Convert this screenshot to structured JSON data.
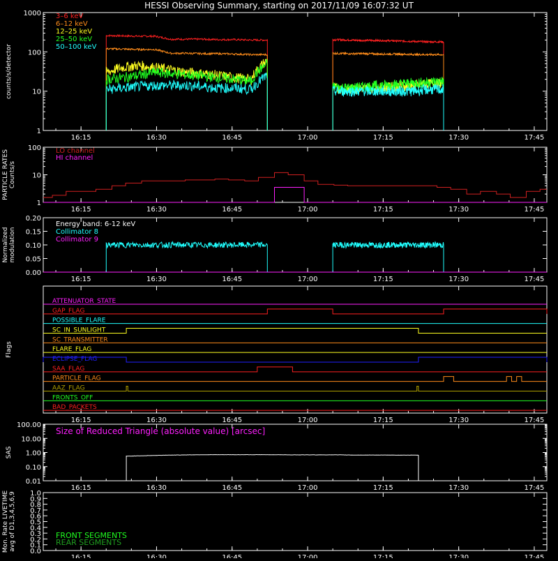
{
  "title": "HESSI Observing Summary, starting on 2017/11/09 16:07:32 UT",
  "time_labels": [
    "16:15",
    "16:30",
    "16:45",
    "17:00",
    "17:15",
    "17:30",
    "17:45"
  ],
  "time_values": [
    7.5,
    22.5,
    37.5,
    52.5,
    67.5,
    82.5,
    97.5
  ],
  "x_range_min": [
    0,
    100
  ],
  "colors": {
    "red": "#ff2020",
    "orange": "#ff8c1a",
    "yellow": "#ffff20",
    "green": "#20ff20",
    "cyan": "#20ffff",
    "magenta": "#ff20ff",
    "blue": "#2020ff",
    "darkred": "#d02020",
    "olive": "#b0a000",
    "sas": "#ffffff",
    "live_front": "#20ff20",
    "live_rear": "#20a020"
  },
  "chart_data": [
    {
      "id": "count-rates",
      "type": "line",
      "ylabel": "counts/s/detector",
      "scale": "log",
      "ylim": [
        1,
        1000
      ],
      "yticks": [
        {
          "v": 1,
          "t": "1"
        },
        {
          "v": 10,
          "t": "10"
        },
        {
          "v": 100,
          "t": "100"
        },
        {
          "v": 1000,
          "t": "1000"
        }
      ],
      "legend": [
        "3–6 keV",
        "6–12 keV",
        "12–25 keV",
        "25–50 keV",
        "50–100 keV"
      ],
      "series": [
        {
          "name": "3–6 keV",
          "color": "red",
          "segments": [
            {
              "t0": 12.5,
              "t1": 44.5,
              "values": [
                260,
                255,
                250,
                250,
                210,
                210,
                210,
                205,
                205,
                200,
                200
              ]
            },
            {
              "t0": 57.5,
              "t1": 79.5,
              "values": [
                205,
                200,
                195,
                195,
                190,
                185,
                180,
                180
              ]
            }
          ]
        },
        {
          "name": "6–12 keV",
          "color": "orange",
          "segments": [
            {
              "t0": 12.5,
              "t1": 44.5,
              "values": [
                120,
                118,
                115,
                115,
                92,
                92,
                90,
                90,
                88,
                85,
                85
              ]
            },
            {
              "t0": 57.5,
              "t1": 79.5,
              "values": [
                92,
                90,
                90,
                88,
                88,
                86,
                85,
                85
              ]
            }
          ]
        },
        {
          "name": "12–25 keV",
          "color": "yellow",
          "segments": [
            {
              "t0": 12.5,
              "t1": 44.5,
              "values": [
                30,
                40,
                45,
                40,
                35,
                30,
                28,
                25,
                22,
                20,
                60
              ]
            },
            {
              "t0": 57.5,
              "t1": 79.5,
              "values": [
                12,
                11,
                12,
                12,
                13,
                14,
                15,
                16
              ]
            }
          ]
        },
        {
          "name": "25–50 keV",
          "color": "green",
          "segments": [
            {
              "t0": 12.5,
              "t1": 44.5,
              "values": [
                20,
                22,
                25,
                30,
                28,
                26,
                24,
                22,
                20,
                18,
                50
              ]
            },
            {
              "t0": 57.5,
              "t1": 79.5,
              "values": [
                13,
                12,
                13,
                14,
                15,
                16,
                17,
                18
              ]
            }
          ]
        },
        {
          "name": "50–100 keV",
          "color": "cyan",
          "segments": [
            {
              "t0": 12.5,
              "t1": 44.5,
              "values": [
                11,
                12,
                13,
                14,
                14,
                14,
                13,
                12,
                12,
                11,
                25
              ]
            },
            {
              "t0": 57.5,
              "t1": 79.5,
              "values": [
                10,
                10,
                10,
                10,
                10,
                10,
                11,
                11
              ]
            }
          ]
        }
      ]
    },
    {
      "id": "particle-rates",
      "type": "line",
      "ylabel": "PARTICLE RATES Counts/s",
      "scale": "log",
      "ylim": [
        1,
        100
      ],
      "yticks": [
        {
          "v": 1,
          "t": "1"
        },
        {
          "v": 10,
          "t": "10"
        },
        {
          "v": 100,
          "t": "100"
        }
      ],
      "legend": [
        "LO channel",
        "HI channel"
      ],
      "series": [
        {
          "name": "LO channel",
          "color": "darkred",
          "segments": [
            {
              "t0": 0,
              "t1": 100,
              "values": [
                1.5,
                1.8,
                2.5,
                2.5,
                3,
                4,
                5,
                6,
                6,
                6,
                6.5,
                6.5,
                7,
                6.5,
                6,
                8,
                12,
                10,
                6,
                4.5,
                4.2,
                4,
                4,
                4,
                4,
                4,
                4,
                3.5,
                3,
                2,
                2.5,
                2,
                1.5,
                2.5,
                3
              ]
            }
          ]
        },
        {
          "name": "HI channel",
          "color": "magenta",
          "segments": [
            {
              "t0": 0,
              "t1": 100,
              "values": [
                1,
                1,
                1,
                1,
                1,
                1,
                1,
                1,
                1,
                1,
                1,
                1,
                1,
                1,
                1,
                1,
                3.5,
                3.5,
                1,
                1,
                1,
                1,
                1,
                1,
                1,
                1,
                1,
                1,
                1,
                1,
                1,
                1,
                1,
                1,
                1
              ]
            }
          ]
        }
      ]
    },
    {
      "id": "modulation",
      "type": "line",
      "ylabel": "Normalized modulation",
      "scale": "linear",
      "ylim": [
        0,
        0.2
      ],
      "yticks": [
        {
          "v": 0,
          "t": "0.00"
        },
        {
          "v": 0.05,
          "t": "0.05"
        },
        {
          "v": 0.1,
          "t": "0.10"
        },
        {
          "v": 0.15,
          "t": "0.15"
        },
        {
          "v": 0.2,
          "t": "0.20"
        }
      ],
      "legend": [
        "Energy band: 6-12 keV",
        "Collimator 8",
        "Collimator 9"
      ],
      "series": [
        {
          "name": "Collimator 8",
          "color": "cyan",
          "segments": [
            {
              "t0": 12.5,
              "t1": 44.5,
              "values": [
                0.1,
                0.1,
                0.1,
                0.1,
                0.1,
                0.1,
                0.1,
                0.1,
                0.1,
                0.1,
                0.1
              ]
            },
            {
              "t0": 57.5,
              "t1": 79.5,
              "values": [
                0.1,
                0.1,
                0.1,
                0.1,
                0.1,
                0.1,
                0.1,
                0.1
              ]
            }
          ]
        },
        {
          "name": "Collimator 9",
          "color": "magenta",
          "segments": [
            {
              "t0": 0,
              "t1": 100,
              "values": [
                0,
                0
              ]
            }
          ]
        }
      ]
    },
    {
      "id": "flags",
      "type": "line",
      "ylabel": "Flags",
      "flags": [
        {
          "name": "ATTENUATOR_STATE",
          "color": "magenta",
          "on": []
        },
        {
          "name": "GAP_FLAG",
          "color": "red",
          "on": [
            [
              44.5,
              57.5
            ],
            [
              79.5,
              100
            ]
          ]
        },
        {
          "name": "POSSIBLE_FLARE",
          "color": "cyan",
          "on": []
        },
        {
          "name": "SC_IN_SUNLIGHT",
          "color": "yellow",
          "on": [
            [
              16.5,
              74.5
            ]
          ]
        },
        {
          "name": "SC_TRANSMITTER",
          "color": "orange",
          "on": []
        },
        {
          "name": "FLARE_FLAG",
          "color": "yellow",
          "on": []
        },
        {
          "name": "ECLIPSE_FLAG",
          "color": "blue",
          "on": [
            [
              0,
              16.5
            ],
            [
              74.5,
              100
            ]
          ]
        },
        {
          "name": "SAA_FLAG",
          "color": "red",
          "on": [
            [
              42.5,
              49.5
            ]
          ]
        },
        {
          "name": "PARTICLE_FLAG",
          "color": "orange",
          "on": [
            [
              79.5,
              81.5
            ],
            [
              92,
              93
            ],
            [
              94,
              95
            ]
          ]
        },
        {
          "name": "AAZ_FLAG",
          "color": "olive",
          "on": [
            [
              16.5,
              16.8
            ],
            [
              74.2,
              74.5
            ]
          ]
        },
        {
          "name": "FRONTS_OFF",
          "color": "green",
          "on": []
        },
        {
          "name": "BAD_PACKETS",
          "color": "red",
          "on": []
        }
      ]
    },
    {
      "id": "sas",
      "type": "line",
      "ylabel": "SAS",
      "scale": "log",
      "ylim": [
        0.01,
        100
      ],
      "yticks": [
        {
          "v": 0.01,
          "t": "0.01"
        },
        {
          "v": 0.1,
          "t": "0.10"
        },
        {
          "v": 1,
          "t": "1.00"
        },
        {
          "v": 10,
          "t": "10.00"
        },
        {
          "v": 100,
          "t": "100.00"
        }
      ],
      "legend": [
        "Size of Reduced Triangle (absolute value) [arcsec]"
      ],
      "series": [
        {
          "name": "Size of Reduced Triangle (absolute value) [arcsec]",
          "color": "sas",
          "segments": [
            {
              "t0": 16.5,
              "t1": 74.5,
              "values": [
                0.55,
                0.6,
                0.65,
                0.68,
                0.7,
                0.7,
                0.7,
                0.7,
                0.68,
                0.68,
                0.68,
                0.66,
                0.66,
                0.65,
                0.65
              ]
            }
          ]
        }
      ]
    },
    {
      "id": "livetime",
      "type": "line",
      "ylabel": "Mon. Rate LIVETIME avg of D1,3,4,5,6,9",
      "scale": "linear",
      "ylim": [
        0,
        1
      ],
      "yticks": [
        {
          "v": 0,
          "t": "0.0"
        },
        {
          "v": 0.1,
          "t": "0.1"
        },
        {
          "v": 0.2,
          "t": "0.2"
        },
        {
          "v": 0.3,
          "t": "0.3"
        },
        {
          "v": 0.4,
          "t": "0.4"
        },
        {
          "v": 0.5,
          "t": "0.5"
        },
        {
          "v": 0.6,
          "t": "0.6"
        },
        {
          "v": 0.7,
          "t": "0.7"
        },
        {
          "v": 0.8,
          "t": "0.8"
        },
        {
          "v": 0.9,
          "t": "0.9"
        },
        {
          "v": 1,
          "t": "1.0"
        }
      ],
      "legend": [
        "FRONT SEGMENTS",
        "REAR SEGMENTS"
      ],
      "series": []
    }
  ]
}
